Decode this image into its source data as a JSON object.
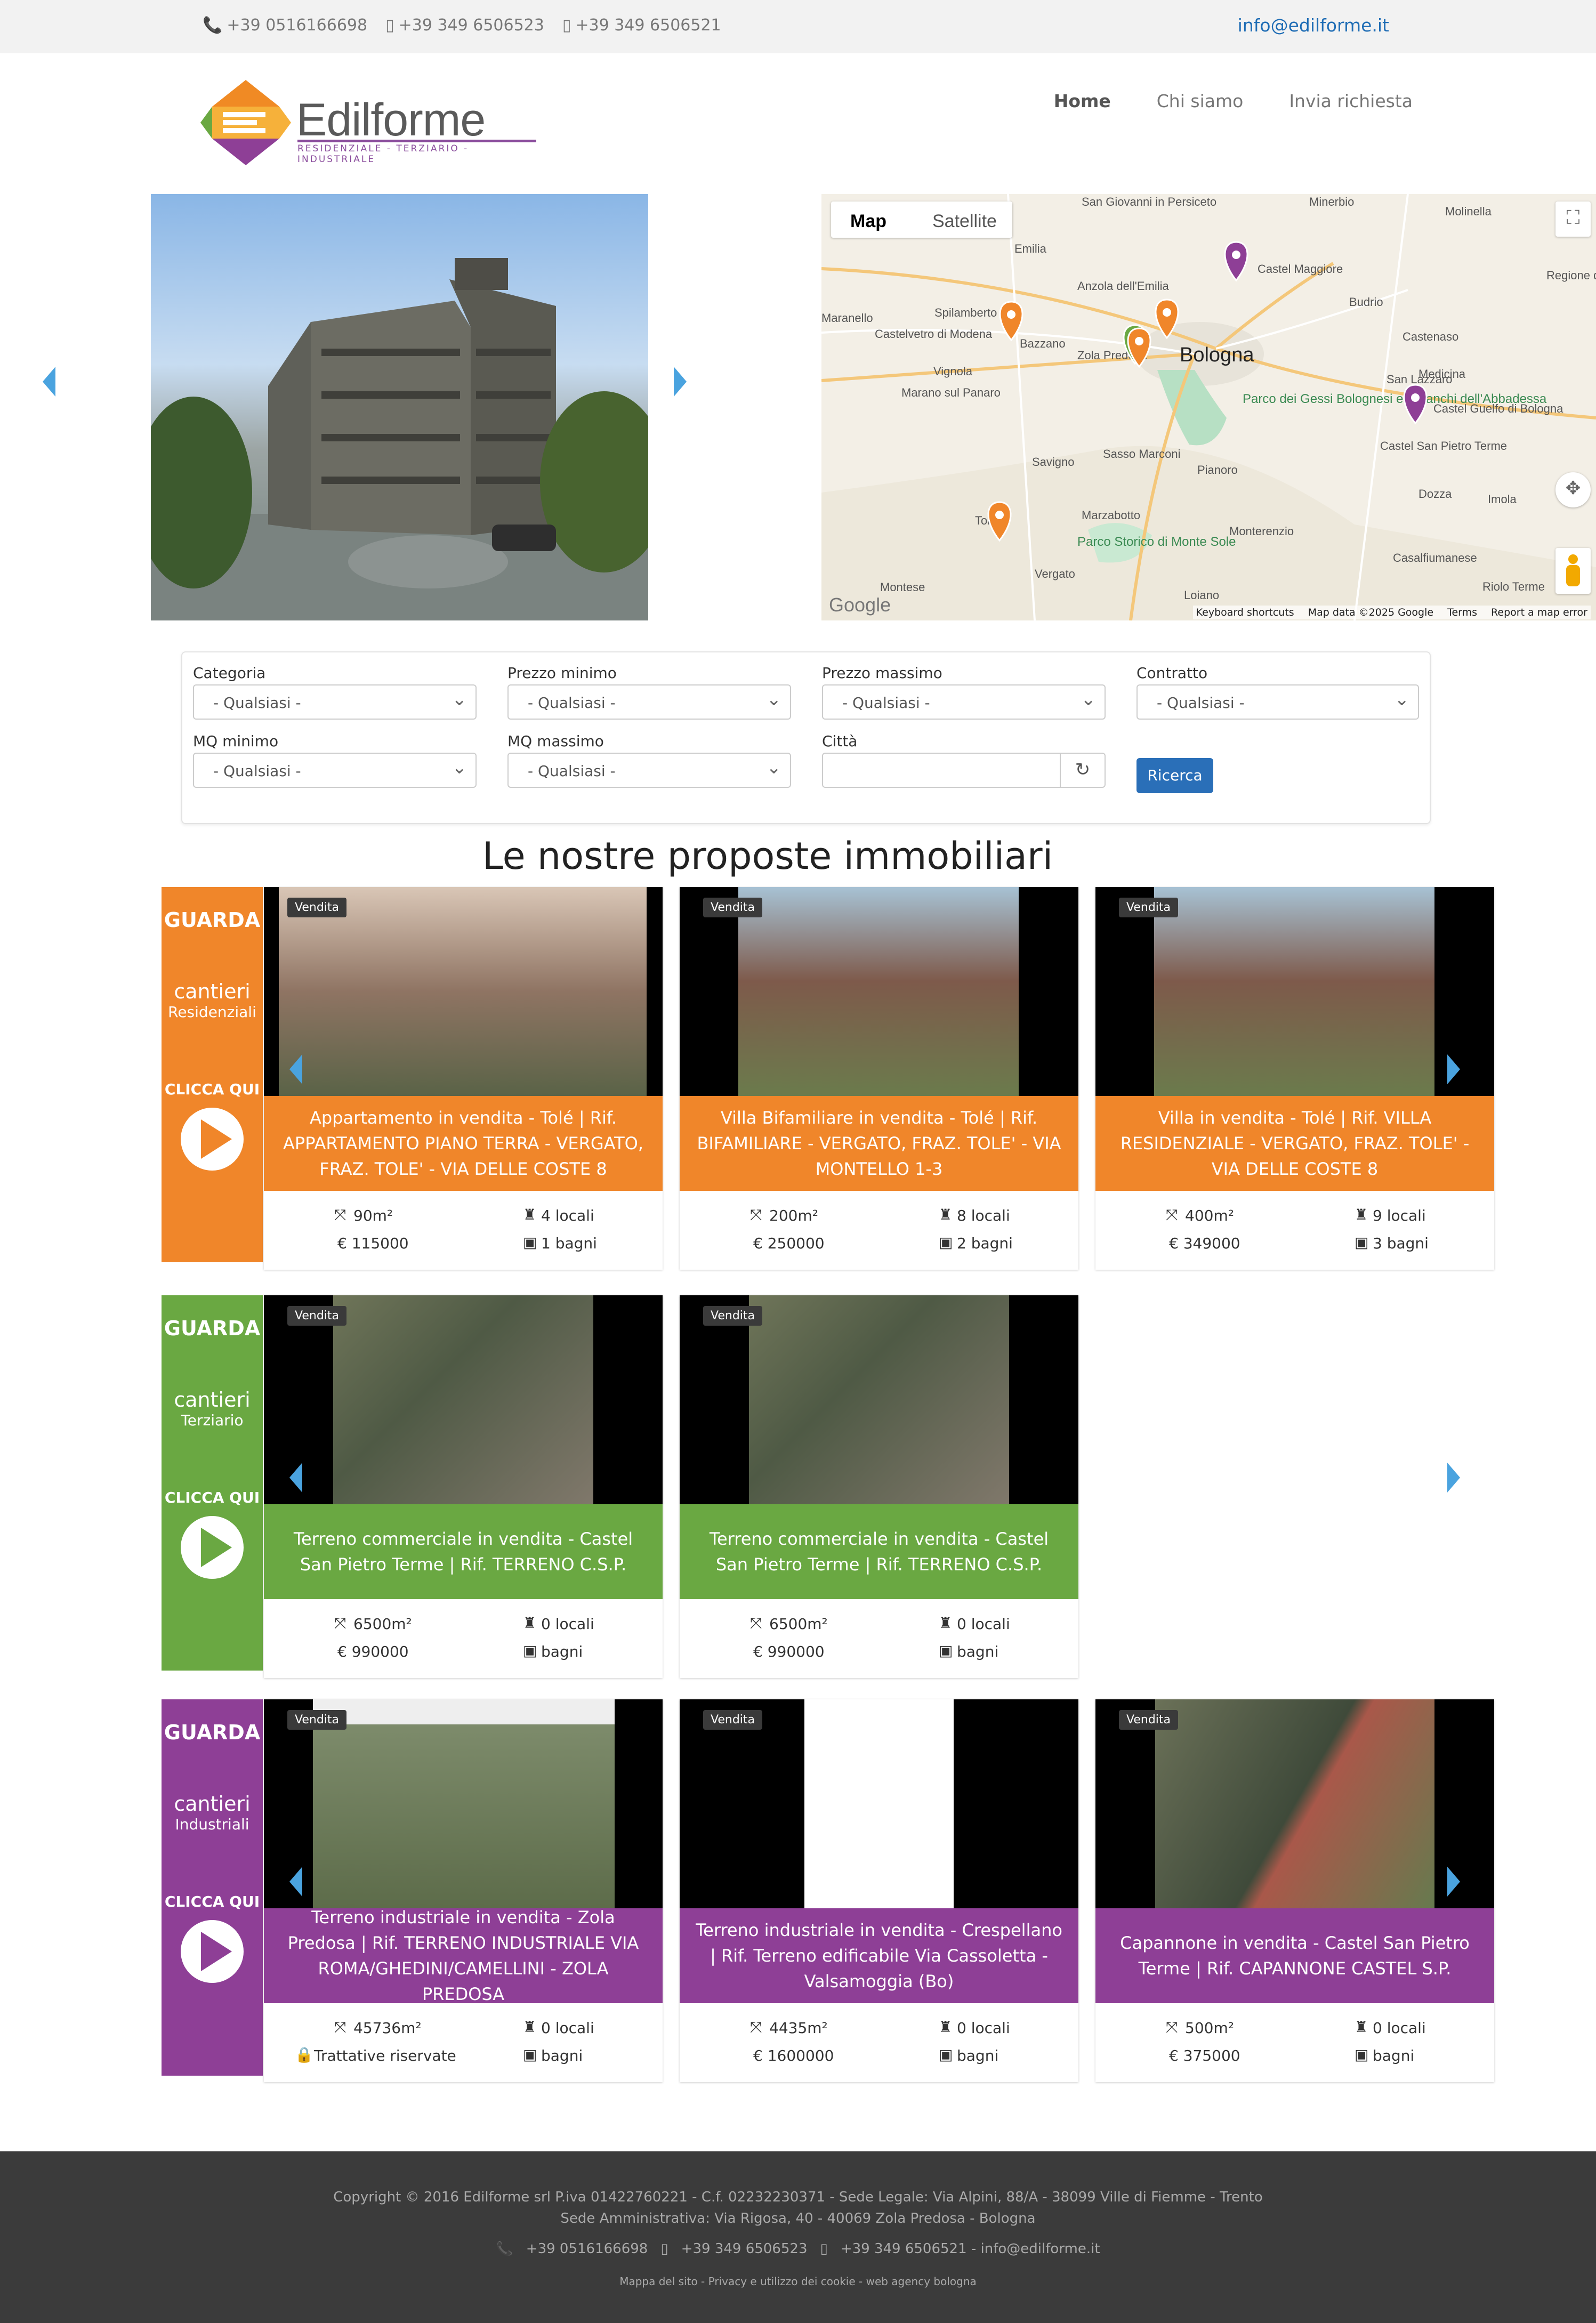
{
  "topbar": {
    "phone1": "+39 0516166698",
    "phone2": "+39 349 6506523",
    "phone3": "+39 349 6506521",
    "email": "info@edilforme.it"
  },
  "logo": {
    "name": "Edilforme",
    "tagline": "RESIDENZIALE - TERZIARIO - INDUSTRIALE"
  },
  "nav": {
    "items": [
      "Home",
      "Chi siamo",
      "Invia richiesta"
    ]
  },
  "map": {
    "tab_map": "Map",
    "tab_satellite": "Satellite",
    "city": "Bologna",
    "footer": [
      "Keyboard shortcuts",
      "Map data ©2025 Google",
      "Terms",
      "Report a map error"
    ],
    "places": [
      "San Giovanni in Persiceto",
      "Minerbio",
      "Molinella",
      "Castel Maggiore",
      "Emilia",
      "Anzola dell'Emilia",
      "Budrio",
      "Regione del Delta del Po (Val",
      "Spilamberto",
      "Bazzano",
      "Castenaso",
      "Maranello",
      "Castelvetro di Modena",
      "Zola Predosa",
      "Vignola",
      "Medicina",
      "San Lazzaro",
      "Marano sul Panaro",
      "Parco dei Gessi Bolognesi e Calanchi dell'Abbadessa",
      "Castel Guelfo di Bologna",
      "Savigno",
      "Sasso Marconi",
      "Pianoro",
      "Castel San Pietro Terme",
      "Dozza",
      "Imola",
      "Tolè",
      "Marzabotto",
      "Monterenzio",
      "Parco Storico di Monte Sole",
      "Casalfiumanese",
      "Vergato",
      "Montese",
      "Loiano",
      "Riolo Terme"
    ]
  },
  "search": {
    "categoria": "Categoria",
    "prezzo_min": "Prezzo minimo",
    "prezzo_max": "Prezzo massimo",
    "contratto": "Contratto",
    "mq_min": "MQ minimo",
    "mq_max": "MQ massimo",
    "citta": "Città",
    "any": "- Qualsiasi -",
    "button": "Ricerca"
  },
  "heading": "Le nostre proposte immobiliari",
  "rows": [
    {
      "guarda": "GUARDA",
      "cantieri": "cantieri",
      "type": "Residenziali",
      "clicca": "CLICCA QUI",
      "color": "#f0862a",
      "cards": [
        {
          "badge": "Vendita",
          "title": "Appartamento in vendita - Tolé | Rif. APPARTAMENTO PIANO TERRA - VERGATO, FRAZ. TOLE' - VIA DELLE COSTE 8",
          "mq": "90m²",
          "locali": "4 locali",
          "prezzo": "€ 115000",
          "bagni": "1 bagni"
        },
        {
          "badge": "Vendita",
          "title": "Villa Bifamiliare in vendita - Tolé | Rif. BIFAMILIARE - VERGATO, FRAZ. TOLE' - VIA MONTELLO 1-3",
          "mq": "200m²",
          "locali": "8 locali",
          "prezzo": "€ 250000",
          "bagni": "2 bagni"
        },
        {
          "badge": "Vendita",
          "title": "Villa in vendita - Tolé | Rif. VILLA RESIDENZIALE - VERGATO, FRAZ. TOLE' - VIA DELLE COSTE 8",
          "mq": "400m²",
          "locali": "9 locali",
          "prezzo": "€ 349000",
          "bagni": "3 bagni"
        }
      ]
    },
    {
      "guarda": "GUARDA",
      "cantieri": "cantieri",
      "type": "Terziario",
      "clicca": "CLICCA QUI",
      "color": "#6aa842",
      "cards": [
        {
          "badge": "Vendita",
          "title": "Terreno commerciale in vendita - Castel San Pietro Terme | Rif. TERRENO C.S.P.",
          "mq": "6500m²",
          "locali": "0 locali",
          "prezzo": "€ 990000",
          "bagni": "bagni"
        },
        {
          "badge": "Vendita",
          "title": "Terreno commerciale in vendita - Castel San Pietro Terme | Rif. TERRENO C.S.P.",
          "mq": "6500m²",
          "locali": "0 locali",
          "prezzo": "€ 990000",
          "bagni": "bagni"
        }
      ]
    },
    {
      "guarda": "GUARDA",
      "cantieri": "cantieri",
      "type": "Industriali",
      "clicca": "CLICCA QUI",
      "color": "#8e3f96",
      "cards": [
        {
          "badge": "Vendita",
          "title": "Terreno industriale in vendita - Zola Predosa | Rif. TERRENO INDUSTRIALE VIA ROMA/GHEDINI/CAMELLINI - ZOLA PREDOSA",
          "mq": "45736m²",
          "locali": "0 locali",
          "prezzo": "Trattative riservate",
          "bagni": "bagni"
        },
        {
          "badge": "Vendita",
          "title": "Terreno industriale in vendita - Crespellano | Rif. Terreno edificabile Via Cassoletta - Valsamoggia (Bo)",
          "mq": "4435m²",
          "locali": "0 locali",
          "prezzo": "€ 1600000",
          "bagni": "bagni"
        },
        {
          "badge": "Vendita",
          "title": "Capannone in vendita - Castel San Pietro Terme | Rif. CAPANNONE CASTEL S.P.",
          "mq": "500m²",
          "locali": "0 locali",
          "prezzo": "€ 375000",
          "bagni": "bagni"
        }
      ]
    }
  ],
  "footer": {
    "line1": "Copyright © 2016 Edilforme srl P.iva 01422760221 - C.f. 02232230371 - Sede Legale: Via Alpini, 88/A - 38099 Ville di Fiemme - Trento",
    "line2": "Sede Amministrativa: Via Rigosa, 40 - 40069 Zola Predosa - Bologna",
    "phone1": "+39 0516166698",
    "phone2": "+39 349 6506523",
    "phone3": "+39 349 6506521 - info@edilforme.it",
    "links": "Mappa del sito - Privacy e utilizzo dei cookie - web agency bologna"
  }
}
